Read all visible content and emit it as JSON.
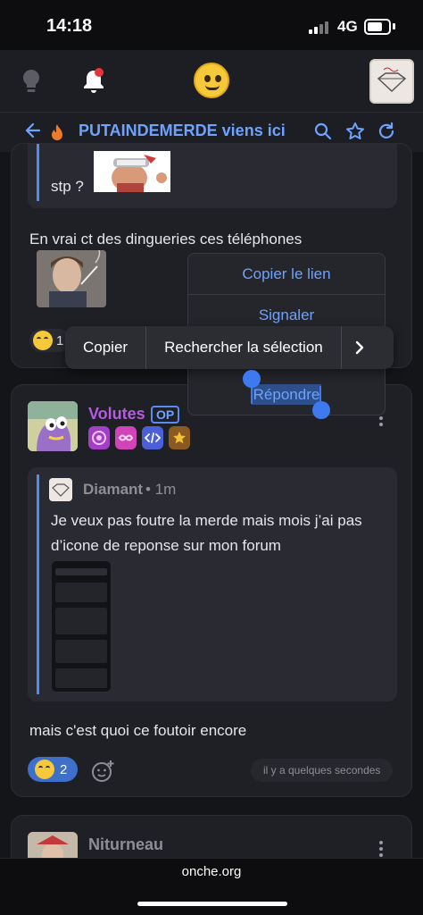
{
  "status_bar": {
    "time": "14:18",
    "network": "4G"
  },
  "topic": {
    "title": "PUTAINDEMERDE viens ici"
  },
  "post1": {
    "quote_text": "stp ?",
    "text": "En vrai ct des dingueries ces téléphones",
    "reaction_count": "1"
  },
  "context_menu": {
    "copy_link": "Copier le lien",
    "report": "Signaler",
    "reply": "Répondre"
  },
  "selection_actions": {
    "copy": "Copier",
    "search": "Rechercher la sélection"
  },
  "post2": {
    "author": "Volutes",
    "op_badge": "OP",
    "quote_author": "Diamant",
    "quote_time": "• 1m",
    "quote_text": "Je veux pas foutre la merde mais mois j’ai pas d’icone de reponse sur mon forum",
    "text": "mais c'est quoi ce foutoir encore",
    "reaction_count": "2",
    "timestamp": "il y a quelques secondes"
  },
  "post3": {
    "author": "Niturneau"
  },
  "browser": {
    "url": "onche.org"
  },
  "icons": {
    "bulb": "bulb-icon",
    "bell": "bell-icon",
    "back": "arrow-left-icon",
    "fire": "fire-icon",
    "search": "search-icon",
    "star": "star-icon",
    "refresh": "refresh-icon",
    "more": "more-vertical-icon",
    "add_reaction": "add-reaction-icon",
    "chevron": "chevron-right-icon"
  },
  "colors": {
    "accent": "#6ea2ff",
    "author_purple": "#b45be0",
    "notification": "#e5373b",
    "reaction_active": "#3e6fc9"
  }
}
